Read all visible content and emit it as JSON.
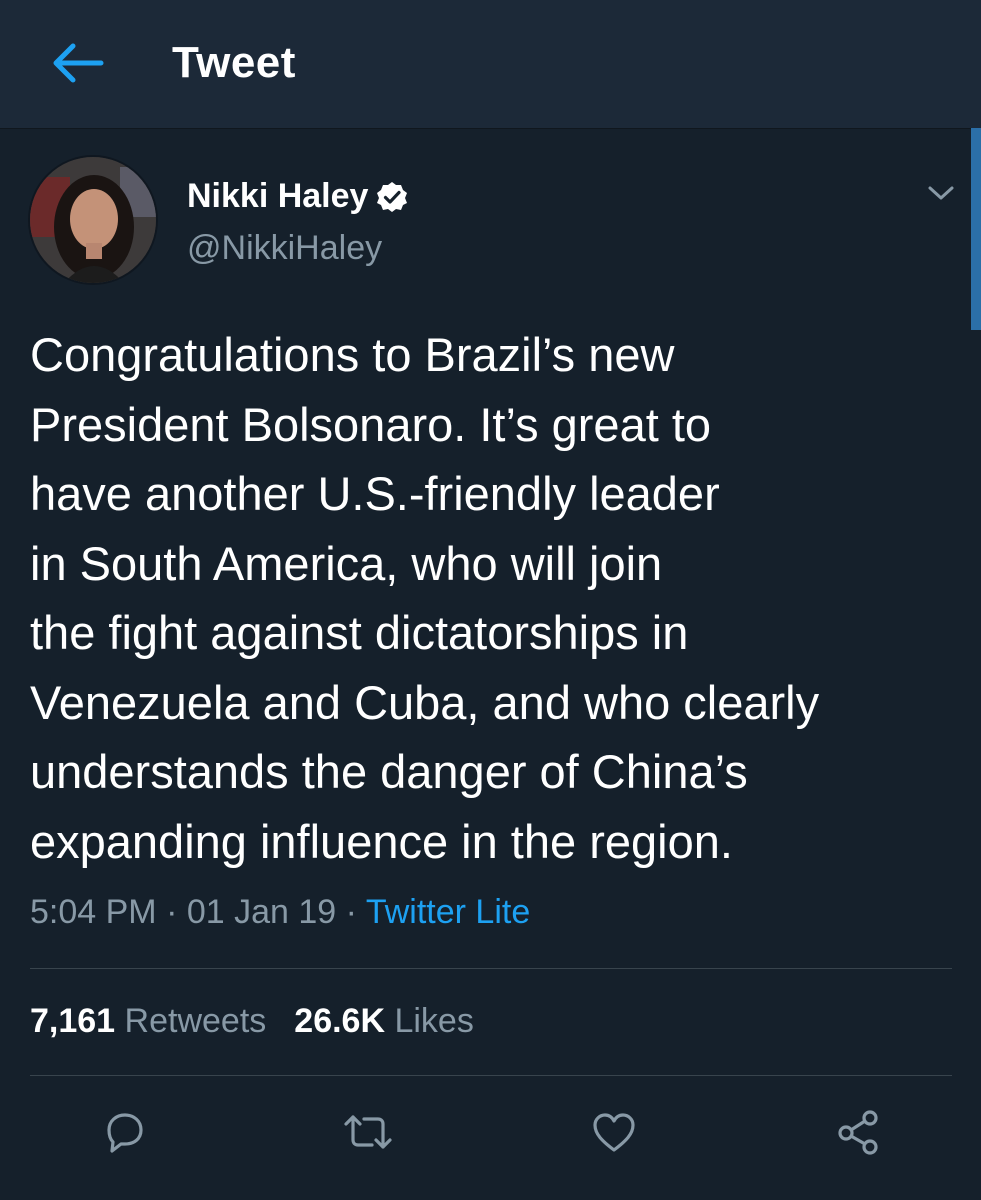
{
  "header": {
    "title": "Tweet",
    "back_icon": "arrow-left-icon"
  },
  "colors": {
    "background": "#15202b",
    "header": "#1c2938",
    "accent": "#1da1f2",
    "muted": "#8899a6",
    "divider": "#38444d"
  },
  "tweet": {
    "display_name": "Nikki Haley",
    "verified_icon": "verified-badge-icon",
    "handle": "@NikkiHaley",
    "more_icon": "chevron-down-icon",
    "text": "Congratulations to Brazil’s new\nPresident Bolsonaro.  It’s great to\nhave another U.S.-friendly leader\nin South America, who will join\nthe fight against dictatorships in\nVenezuela and Cuba, and who clearly\nunderstands the danger of China’s\nexpanding influence in the region.",
    "time": "5:04 PM",
    "date": "01 Jan 19",
    "source": "Twitter Lite",
    "separator": "·"
  },
  "stats": {
    "retweets_count": "7,161",
    "retweets_label": "Retweets",
    "likes_count": "26.6K",
    "likes_label": "Likes"
  },
  "actions": [
    {
      "icon": "reply-icon"
    },
    {
      "icon": "retweet-icon"
    },
    {
      "icon": "heart-icon"
    },
    {
      "icon": "share-icon"
    }
  ]
}
